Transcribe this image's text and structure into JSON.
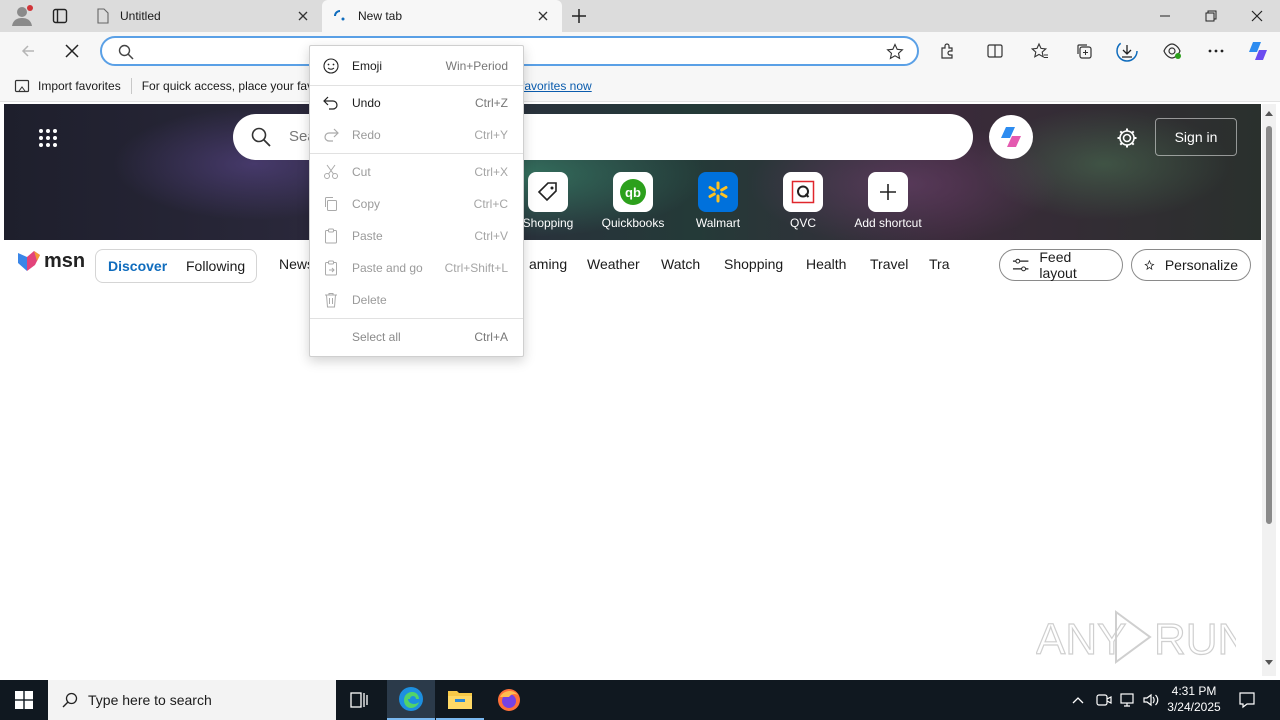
{
  "browser": {
    "tabs": [
      {
        "label": "Untitled"
      },
      {
        "label": "New tab"
      }
    ],
    "address": {
      "value": "",
      "placeholder": ""
    },
    "favorites_bar": {
      "import_label": "Import favorites",
      "hint_text": "For quick access, place your fav",
      "link_text": "favorites now"
    }
  },
  "page": {
    "hero": {
      "search_placeholder": "Sea",
      "signin_label": "Sign in"
    },
    "shortcuts": [
      {
        "label": "Shopping"
      },
      {
        "label": "Quickbooks"
      },
      {
        "label": "Walmart"
      },
      {
        "label": "QVC"
      },
      {
        "label": "Add shortcut"
      }
    ],
    "brand": "msn",
    "tabs": {
      "discover": "Discover",
      "following": "Following"
    },
    "nav": [
      "News",
      "aming",
      "Weather",
      "Watch",
      "Shopping",
      "Health",
      "Travel",
      "Tra"
    ],
    "feed_layout_label": "Feed layout",
    "personalize_label": "Personalize"
  },
  "context_menu": {
    "items": [
      {
        "label": "Emoji",
        "shortcut": "Win+Period",
        "icon": "emoji-icon",
        "enabled": true
      },
      {
        "label": "Undo",
        "shortcut": "Ctrl+Z",
        "icon": "undo-icon",
        "enabled": true
      },
      {
        "label": "Redo",
        "shortcut": "Ctrl+Y",
        "icon": "redo-icon",
        "enabled": false
      },
      {
        "label": "Cut",
        "shortcut": "Ctrl+X",
        "icon": "cut-icon",
        "enabled": false
      },
      {
        "label": "Copy",
        "shortcut": "Ctrl+C",
        "icon": "copy-icon",
        "enabled": false
      },
      {
        "label": "Paste",
        "shortcut": "Ctrl+V",
        "icon": "paste-icon",
        "enabled": false
      },
      {
        "label": "Paste and go",
        "shortcut": "Ctrl+Shift+L",
        "icon": "paste-go-icon",
        "enabled": false
      },
      {
        "label": "Delete",
        "shortcut": "",
        "icon": "delete-icon",
        "enabled": false
      },
      {
        "label": "Select all",
        "shortcut": "Ctrl+A",
        "icon": "",
        "enabled": true
      }
    ]
  },
  "taskbar": {
    "search_placeholder": "Type here to search",
    "time": "4:31 PM",
    "date": "3/24/2025"
  },
  "watermark": "ANY RUN",
  "colors": {
    "accent": "#0f6cbd",
    "address_focus": "#5aa0e6",
    "taskbar": "#101820",
    "qb_green": "#2ca01c",
    "walmart_blue": "#0071dc",
    "qvc_red": "#e0262c"
  }
}
